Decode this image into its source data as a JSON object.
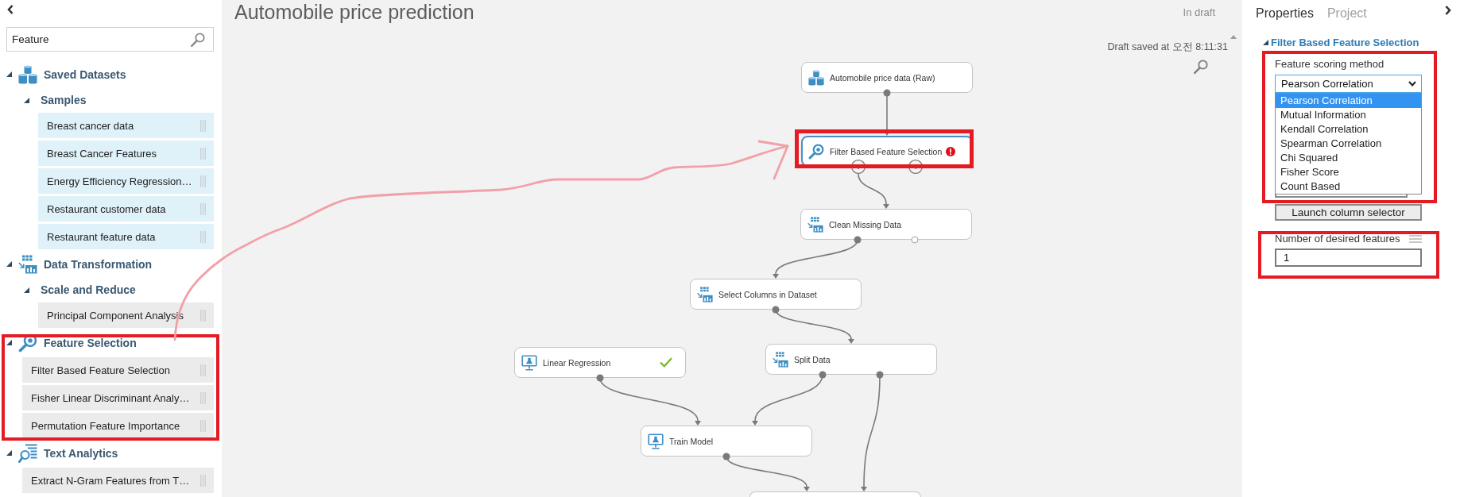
{
  "sidebar": {
    "search": {
      "value": "Feature"
    },
    "tree": [
      {
        "label": "Saved Datasets",
        "kind": "datasets",
        "expanded": true,
        "highlighted": false,
        "children": [
          {
            "label": "Samples",
            "kind": "group",
            "expanded": true,
            "children": [
              {
                "label": "Breast cancer data",
                "kind": "dataset"
              },
              {
                "label": "Breast Cancer Features",
                "kind": "dataset"
              },
              {
                "label": "Energy Efficiency Regression…",
                "kind": "dataset"
              },
              {
                "label": "Restaurant customer data",
                "kind": "dataset"
              },
              {
                "label": "Restaurant feature data",
                "kind": "dataset"
              }
            ]
          }
        ]
      },
      {
        "label": "Data Transformation",
        "kind": "transformation",
        "expanded": true,
        "highlighted": false,
        "children": [
          {
            "label": "Scale and Reduce",
            "kind": "group",
            "expanded": true,
            "children": [
              {
                "label": "Principal Component Analysis",
                "kind": "module"
              }
            ]
          }
        ]
      },
      {
        "label": "Feature Selection",
        "kind": "feature-selection",
        "expanded": true,
        "highlighted": true,
        "children": [
          {
            "label": "Filter Based Feature Selection",
            "kind": "module"
          },
          {
            "label": "Fisher Linear Discriminant Analy…",
            "kind": "module"
          },
          {
            "label": "Permutation Feature Importance",
            "kind": "module"
          }
        ]
      },
      {
        "label": "Text Analytics",
        "kind": "text-analytics",
        "expanded": true,
        "highlighted": false,
        "children": [
          {
            "label": "Extract N-Gram Features from T…",
            "kind": "module"
          }
        ]
      }
    ]
  },
  "canvas": {
    "title": "Automobile price prediction",
    "status": "In draft",
    "saved_note": "Draft saved at 오전 8:11:31",
    "nodes": [
      {
        "label": "Automobile price data (Raw)",
        "kind": "dataset",
        "selected": false,
        "highlighted": false,
        "error": false,
        "finished": false
      },
      {
        "label": "Filter Based Feature Selection",
        "kind": "feature-selection",
        "selected": true,
        "highlighted": true,
        "error": true,
        "finished": false
      },
      {
        "label": "Clean Missing Data",
        "kind": "transformation",
        "selected": false,
        "highlighted": false,
        "error": false,
        "finished": false
      },
      {
        "label": "Select Columns in Dataset",
        "kind": "transformation",
        "selected": false,
        "highlighted": false,
        "error": false,
        "finished": false
      },
      {
        "label": "Linear Regression",
        "kind": "model",
        "selected": false,
        "highlighted": false,
        "error": false,
        "finished": true
      },
      {
        "label": "Split Data",
        "kind": "transformation",
        "selected": false,
        "highlighted": false,
        "error": false,
        "finished": false
      },
      {
        "label": "Train Model",
        "kind": "model",
        "selected": false,
        "highlighted": false,
        "error": false,
        "finished": false
      },
      {
        "selected": false,
        "highlighted": false
      }
    ]
  },
  "properties": {
    "tabs": [
      {
        "label": "Properties",
        "selected": true
      },
      {
        "label": "Project",
        "selected": false
      }
    ],
    "section": {
      "title": "Filter Based Feature Selection",
      "expanded": true
    },
    "fields": [
      {
        "kind": "dropdown",
        "label": "Feature scoring method",
        "value": "Pearson Correlation",
        "open": true,
        "highlighted": true,
        "options": [
          {
            "label": "Pearson Correlation",
            "selected": true
          },
          {
            "label": "Mutual Information",
            "selected": false
          },
          {
            "label": "Kendall Correlation",
            "selected": false
          },
          {
            "label": "Spearman Correlation",
            "selected": false
          },
          {
            "label": "Chi Squared",
            "selected": false
          },
          {
            "label": "Fisher Score",
            "selected": false
          },
          {
            "label": "Count Based",
            "selected": false
          }
        ]
      },
      {
        "kind": "column-picker",
        "button": "Launch column selector",
        "highlighted": false
      },
      {
        "kind": "number",
        "label": "Number of desired features",
        "value": "1",
        "highlighted": true
      }
    ]
  }
}
